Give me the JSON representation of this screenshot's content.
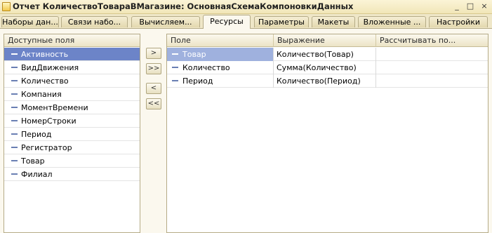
{
  "window": {
    "title": "Отчет КоличествоТовараВМагазине: ОсновнаяСхемаКомпоновкиДанных",
    "minimize_glyph": "_",
    "maximize_glyph": "□",
    "close_glyph": "×"
  },
  "tabs": [
    {
      "label": "Наборы дан..."
    },
    {
      "label": "Связи набо..."
    },
    {
      "label": "Вычисляем..."
    },
    {
      "label": "Ресурсы",
      "active": true
    },
    {
      "label": "Параметры"
    },
    {
      "label": "Макеты"
    },
    {
      "label": "Вложенные ..."
    },
    {
      "label": "Настройки"
    }
  ],
  "available_fields": {
    "header": "Доступные поля",
    "items": [
      {
        "label": "Активность",
        "selected": true
      },
      {
        "label": "ВидДвижения"
      },
      {
        "label": "Количество"
      },
      {
        "label": "Компания"
      },
      {
        "label": "МоментВремени"
      },
      {
        "label": "НомерСтроки"
      },
      {
        "label": "Период"
      },
      {
        "label": "Регистратор"
      },
      {
        "label": "Товар"
      },
      {
        "label": "Филиал"
      }
    ]
  },
  "move_buttons": {
    "add": ">",
    "add_all": ">>",
    "remove": "<",
    "remove_all": "<<"
  },
  "resources": {
    "columns": [
      "Поле",
      "Выражение",
      "Рассчитывать по..."
    ],
    "rows": [
      {
        "field": "Товар",
        "expression": "Количество(Товар)",
        "calc_by": "",
        "selected": true
      },
      {
        "field": "Количество",
        "expression": "Сумма(Количество)",
        "calc_by": ""
      },
      {
        "field": "Период",
        "expression": "Количество(Период)",
        "calc_by": ""
      }
    ]
  },
  "colors": {
    "selection": "#6c84c8",
    "selection_light": "#9fb1de",
    "chrome": "#efe7c8",
    "border": "#b5ab86"
  }
}
